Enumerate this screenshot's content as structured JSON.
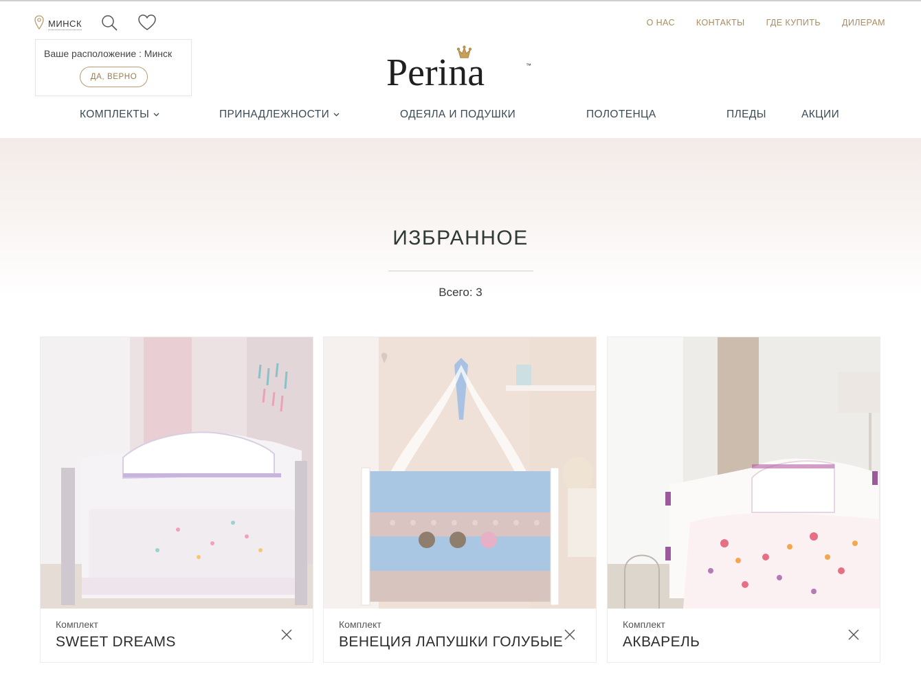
{
  "header": {
    "city": "МИНСК",
    "location_popup": {
      "text": "Ваше расположение :  Минск",
      "confirm_label": "ДА, ВЕРНО"
    },
    "top_links": [
      "О НАС",
      "КОНТАКТЫ",
      "ГДЕ КУПИТЬ",
      "ДИЛЕРАМ"
    ],
    "logo_text": "Perina",
    "logo_tm": "™",
    "icons": [
      "location-pin-icon",
      "search-icon",
      "heart-icon"
    ]
  },
  "nav": {
    "items": [
      {
        "label": "КОМПЛЕКТЫ",
        "has_dropdown": true
      },
      {
        "label": "ПРИНАДЛЕЖНОСТИ",
        "has_dropdown": true
      },
      {
        "label": "ОДЕЯЛА И ПОДУШКИ",
        "has_dropdown": false
      },
      {
        "label": "ПОЛОТЕНЦА",
        "has_dropdown": false
      },
      {
        "label": "ПЛЕДЫ",
        "has_dropdown": false
      },
      {
        "label": "АКЦИИ",
        "has_dropdown": false
      }
    ]
  },
  "page": {
    "title": "ИЗБРАННОЕ",
    "total": "Всего: 3"
  },
  "favorites": [
    {
      "category": "Комплект",
      "name": "SWEET DREAMS"
    },
    {
      "category": "Комплект",
      "name": "ВЕНЕЦИЯ ЛАПУШКИ ГОЛУБЫЕ"
    },
    {
      "category": "Комплект",
      "name": "АКВАРЕЛЬ"
    }
  ],
  "colors": {
    "accent_gold": "#a98b5f",
    "nav_text": "#3a4a55",
    "hero_tint": "#f3ebe8"
  }
}
